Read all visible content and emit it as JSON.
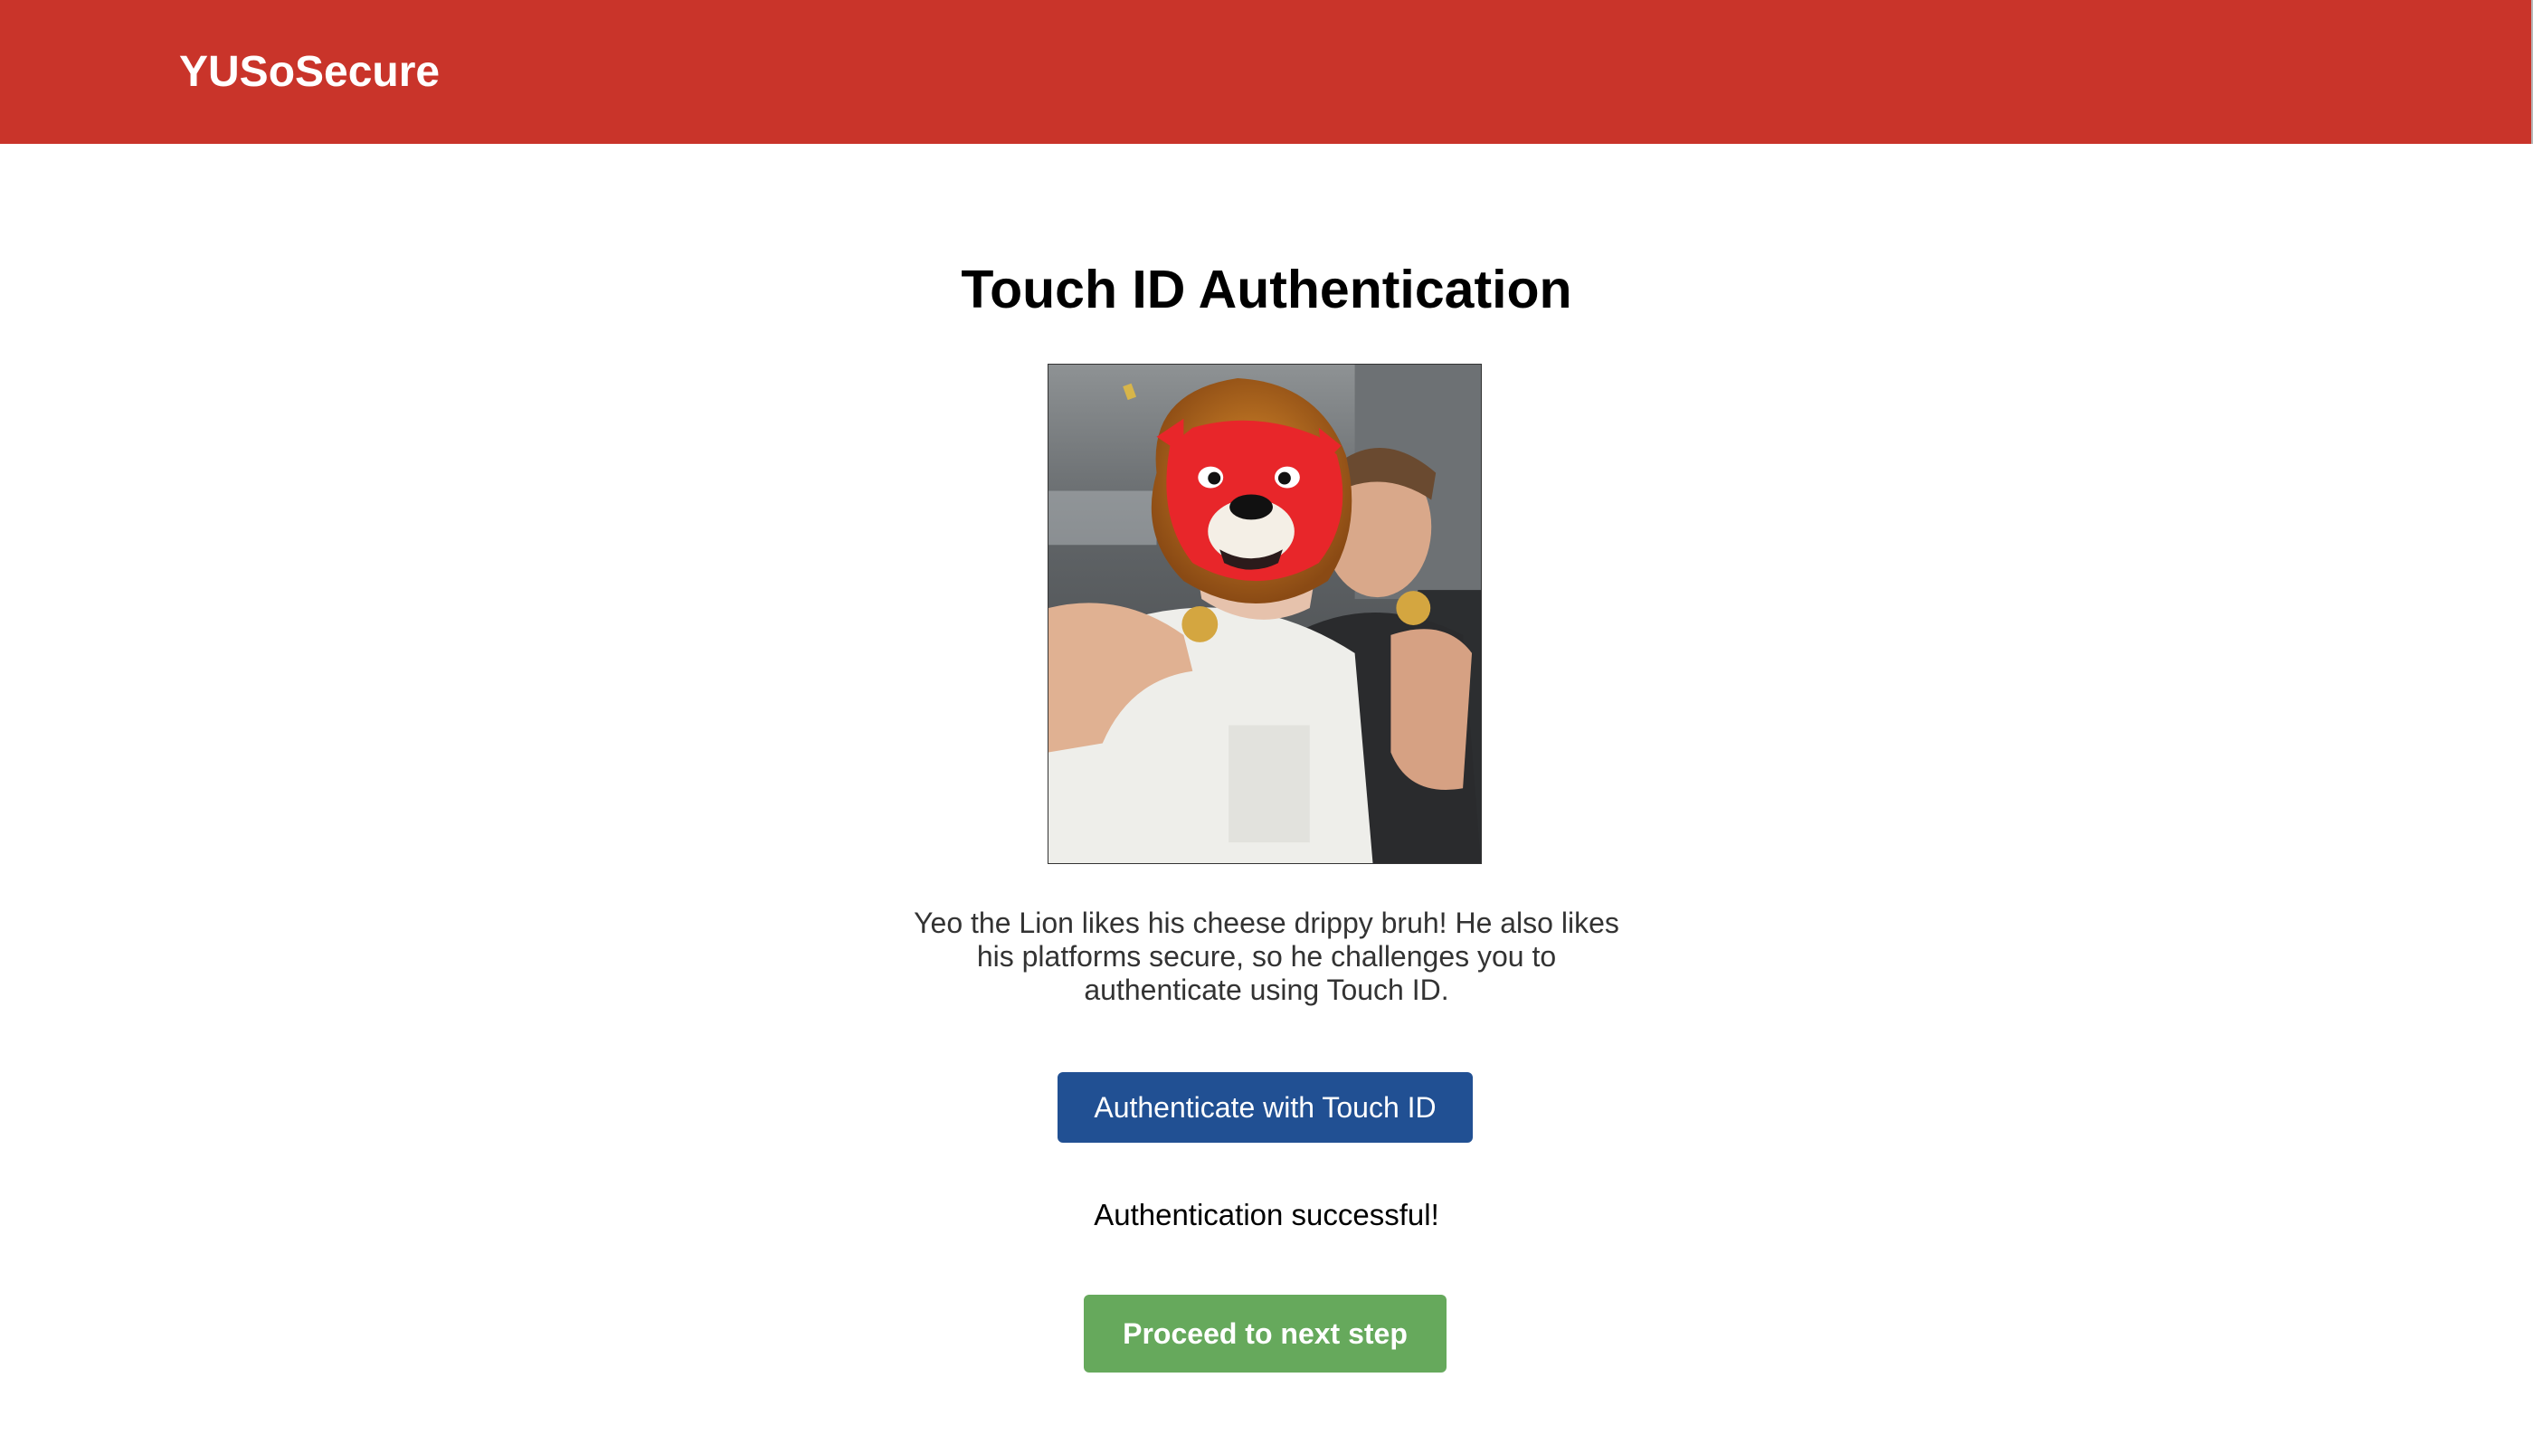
{
  "header": {
    "brand": "YUSoSecure",
    "color": "#c9342a"
  },
  "main": {
    "title": "Touch ID Authentication",
    "image": {
      "icon": "lion-mascot-photo"
    },
    "description": "Yeo the Lion likes his cheese drippy bruh! He also likes his platforms secure, so he challenges you to authenticate using Touch ID.",
    "auth_button_label": "Authenticate with Touch ID",
    "status_text": "Authentication successful!",
    "next_button_label": "Proceed to next step"
  },
  "colors": {
    "header": "#c9342a",
    "primary_button": "#215093",
    "success_button": "#66a95c"
  }
}
